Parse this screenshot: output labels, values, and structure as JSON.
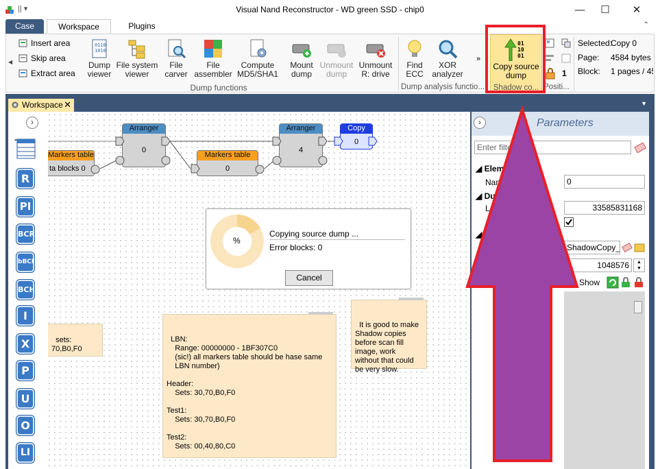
{
  "window": {
    "title": "Visual Nand Reconstructor - WD green SSD - chip0",
    "minimize": "—",
    "maximize": "☐",
    "close": "✕"
  },
  "ribbon_tabs": [
    "Case",
    "Workspace",
    "Plugins"
  ],
  "ribbon": {
    "insert_area": "Insert area",
    "skip_area": "Skip area",
    "extract_area": "Extract area",
    "dump_viewer": [
      "Dump",
      "viewer"
    ],
    "file_system_viewer": [
      "File system",
      "viewer"
    ],
    "file_carver": [
      "File",
      "carver"
    ],
    "file_assembler": [
      "File",
      "assembler"
    ],
    "compute_md5": [
      "Compute",
      "MD5/SHA1"
    ],
    "mount_dump": [
      "Mount",
      "dump"
    ],
    "unmount_dump": [
      "Unmount",
      "dump"
    ],
    "unmount_r": [
      "Unmount",
      "R: drive"
    ],
    "group_dump_functions": "Dump functions",
    "find_ecc": [
      "Find",
      "ECC"
    ],
    "xor_analyzer": [
      "XOR",
      "analyzer"
    ],
    "group_dump_analysis": "Dump analysis functio...",
    "copy_source_dump": [
      "Copy source",
      "dump"
    ],
    "group_shadow": "Shadow co...",
    "group_positi": "Positi...",
    "position_value": "1",
    "selected_label": "Selected:",
    "selected_value": "Copy 0",
    "page_label": "Page:",
    "page_value": "4584 bytes",
    "block_label": "Block:",
    "block_value": "1 pages / 45"
  },
  "doc_tab": "Workspace",
  "left_tools": [
    "R",
    "PI",
    "BCR",
    "bBCR",
    "BCH",
    "I",
    "X",
    "P",
    "U",
    "O",
    "LI"
  ],
  "nodes": {
    "markers_table_1": {
      "title": "Markers table",
      "value": "ta blocks 0"
    },
    "arranger_1": {
      "title": "Arranger",
      "value": "0"
    },
    "markers_table_2": {
      "title": "Markers table",
      "value": "0"
    },
    "arranger_2": {
      "title": "Arranger",
      "value": "4"
    },
    "copy": {
      "title": "Copy",
      "value": "0"
    }
  },
  "progress_dialog": {
    "percent": "%",
    "line1": "Copying source dump ...",
    "line2": "Error blocks: 0",
    "cancel": "Cancel"
  },
  "notes": {
    "left_partial": "sets:\n70,B0,F0",
    "lbn": "LBN:\n    Range: 00000000 - 1BF307C0\n    (sic!) all markers table should be hase same\n    LBN number)\n\nHeader:\n    Sets: 30,70,B0,F0\n\nTest1:\n    Sets: 30,70,B0,F0\n\nTest2:\n    Sets: 00,40,80,C0",
    "shadow_tip": "It is good to make\nShadow copies\nbefore scan fill\nimage, work\nwithout that could\nbe very slow."
  },
  "parameters": {
    "title": "Parameters",
    "filter_placeholder": "Enter filte",
    "section_element": "Elem",
    "name_label": "Nam",
    "name_value": "0",
    "section_du": "Du",
    "length_label": "L",
    "length_value": "33585831168",
    "shadow_file": "ShadowCopy_",
    "size_value": "1048576",
    "show_label": "Show"
  },
  "colors": {
    "arrow_fill": "#9b44a6",
    "arrow_stroke": "#e8202a",
    "highlight_box": "#e8202a",
    "node_header_blue": "#4d8ec4",
    "node_header_orange": "#f5a020",
    "copy_header": "#1f3de0"
  }
}
